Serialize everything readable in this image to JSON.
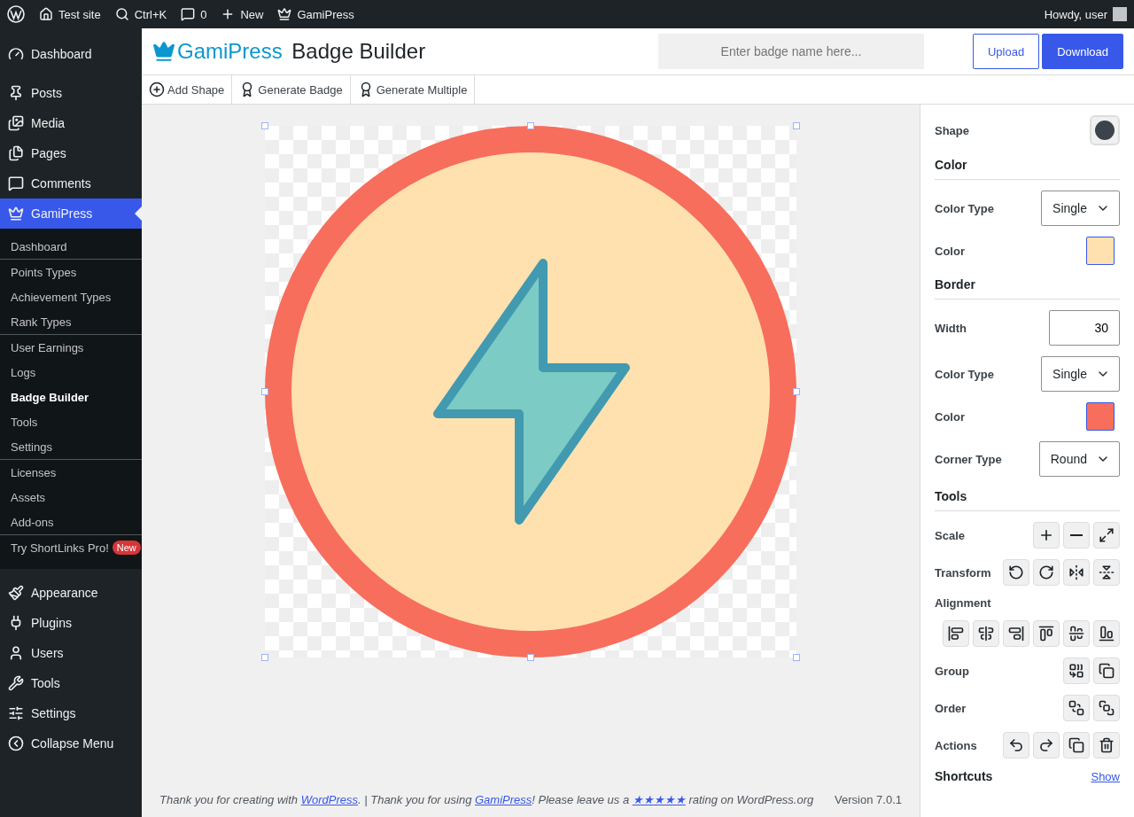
{
  "admin_bar": {
    "items": [
      {
        "kind": "wp"
      },
      {
        "kind": "home",
        "label": "Test site"
      },
      {
        "kind": "search",
        "label": "Ctrl+K"
      },
      {
        "kind": "comment",
        "label": "0"
      },
      {
        "kind": "plus",
        "label": "New"
      },
      {
        "kind": "crown",
        "label": "GamiPress"
      }
    ],
    "greeting": "Howdy, user"
  },
  "sidebar": {
    "items": [
      {
        "kind": "gauge",
        "label": "Dashboard",
        "selected": false
      },
      {
        "kind": "sep"
      },
      {
        "kind": "pin",
        "label": "Posts",
        "selected": false
      },
      {
        "kind": "media",
        "label": "Media",
        "selected": false
      },
      {
        "kind": "pages",
        "label": "Pages",
        "selected": false
      },
      {
        "kind": "comment",
        "label": "Comments",
        "selected": false
      },
      {
        "kind": "crown",
        "label": "GamiPress",
        "selected": true,
        "submenu": [
          [
            {
              "label": "Dashboard",
              "selected": false
            }
          ],
          [
            {
              "label": "Points Types",
              "selected": false
            },
            {
              "label": "Achievement Types",
              "selected": false
            },
            {
              "label": "Rank Types",
              "selected": false
            }
          ],
          [
            {
              "label": "User Earnings",
              "selected": false
            },
            {
              "label": "Logs",
              "selected": false
            },
            {
              "label": "Badge Builder",
              "selected": true
            },
            {
              "label": "Tools",
              "selected": false
            },
            {
              "label": "Settings",
              "selected": false
            }
          ],
          [
            {
              "label": "Licenses",
              "selected": false
            },
            {
              "label": "Assets",
              "selected": false
            },
            {
              "label": "Add-ons",
              "selected": false
            }
          ],
          [
            {
              "label": "Try ShortLinks Pro!",
              "selected": false,
              "badge": "New"
            }
          ]
        ]
      },
      {
        "kind": "brush",
        "label": "Appearance",
        "selected": false
      },
      {
        "kind": "plug",
        "label": "Plugins",
        "selected": false
      },
      {
        "kind": "user",
        "label": "Users",
        "selected": false
      },
      {
        "kind": "wrench",
        "label": "Tools",
        "selected": false
      },
      {
        "kind": "sliders",
        "label": "Settings",
        "selected": false
      },
      {
        "kind": "collapse",
        "label": "Collapse Menu",
        "selected": false
      }
    ]
  },
  "header": {
    "brand": "GamiPress",
    "title": "Badge Builder",
    "search": {
      "placeholder": "Enter badge name here..."
    },
    "buttons": [
      {
        "kind": "outline",
        "label": "Upload"
      },
      {
        "kind": "primary",
        "label": "Download"
      }
    ]
  },
  "toolbar": [
    {
      "kind": "add",
      "label": "Add Shape"
    },
    {
      "kind": "badge",
      "label": "Generate Badge"
    },
    {
      "kind": "badge",
      "label": "Generate Multiple"
    }
  ],
  "panel": [
    {
      "kind": "shape",
      "label": "Shape"
    },
    {
      "kind": "heading",
      "label": "Color"
    },
    {
      "kind": "select",
      "label": "Color Type",
      "value": "Single"
    },
    {
      "kind": "color",
      "label": "Color",
      "color": "#ffe1b0"
    },
    {
      "kind": "heading",
      "label": "Border"
    },
    {
      "kind": "number",
      "label": "Width",
      "value": "30"
    },
    {
      "kind": "select",
      "label": "Color Type",
      "value": "Single"
    },
    {
      "kind": "color",
      "label": "Color",
      "color": "#f76e5c"
    },
    {
      "kind": "select",
      "label": "Corner Type",
      "value": "Round"
    },
    {
      "kind": "heading",
      "label": "Tools"
    },
    {
      "kind": "tools",
      "label": "Scale",
      "buttons": [
        {
          "kind": "plus"
        },
        {
          "kind": "minus"
        },
        {
          "kind": "expand"
        }
      ]
    },
    {
      "kind": "tools",
      "label": "Transform",
      "buttons": [
        {
          "kind": "rotate-left"
        },
        {
          "kind": "rotate-right"
        },
        {
          "kind": "flip-h"
        },
        {
          "kind": "flip-v"
        }
      ]
    },
    {
      "kind": "label",
      "label": "Alignment"
    },
    {
      "kind": "tools",
      "buttons": [
        {
          "kind": "align-left"
        },
        {
          "kind": "align-center"
        },
        {
          "kind": "align-right"
        },
        {
          "kind": "align-top"
        },
        {
          "kind": "align-middle"
        },
        {
          "kind": "align-bottom"
        }
      ]
    },
    {
      "kind": "tools",
      "label": "Group",
      "buttons": [
        {
          "kind": "group"
        },
        {
          "kind": "ungroup"
        }
      ]
    },
    {
      "kind": "tools",
      "label": "Order",
      "buttons": [
        {
          "kind": "back"
        },
        {
          "kind": "front"
        }
      ]
    },
    {
      "kind": "tools",
      "label": "Actions",
      "buttons": [
        {
          "kind": "undo"
        },
        {
          "kind": "redo"
        },
        {
          "kind": "copy"
        },
        {
          "kind": "trash"
        }
      ]
    },
    {
      "kind": "link-row",
      "label": "Shortcuts",
      "link": "Show"
    }
  ],
  "footer": {
    "parts": [
      {
        "kind": "text",
        "text": "Thank you for creating with "
      },
      {
        "kind": "link",
        "text": "WordPress"
      },
      {
        "kind": "text",
        "text": ". | Thank you for using "
      },
      {
        "kind": "link",
        "text": "GamiPress"
      },
      {
        "kind": "text",
        "text": "! Please leave us a "
      },
      {
        "kind": "link",
        "text": "★★★★★"
      },
      {
        "kind": "text",
        "text": " rating on WordPress.org"
      }
    ],
    "version": "Version 7.0.1"
  }
}
